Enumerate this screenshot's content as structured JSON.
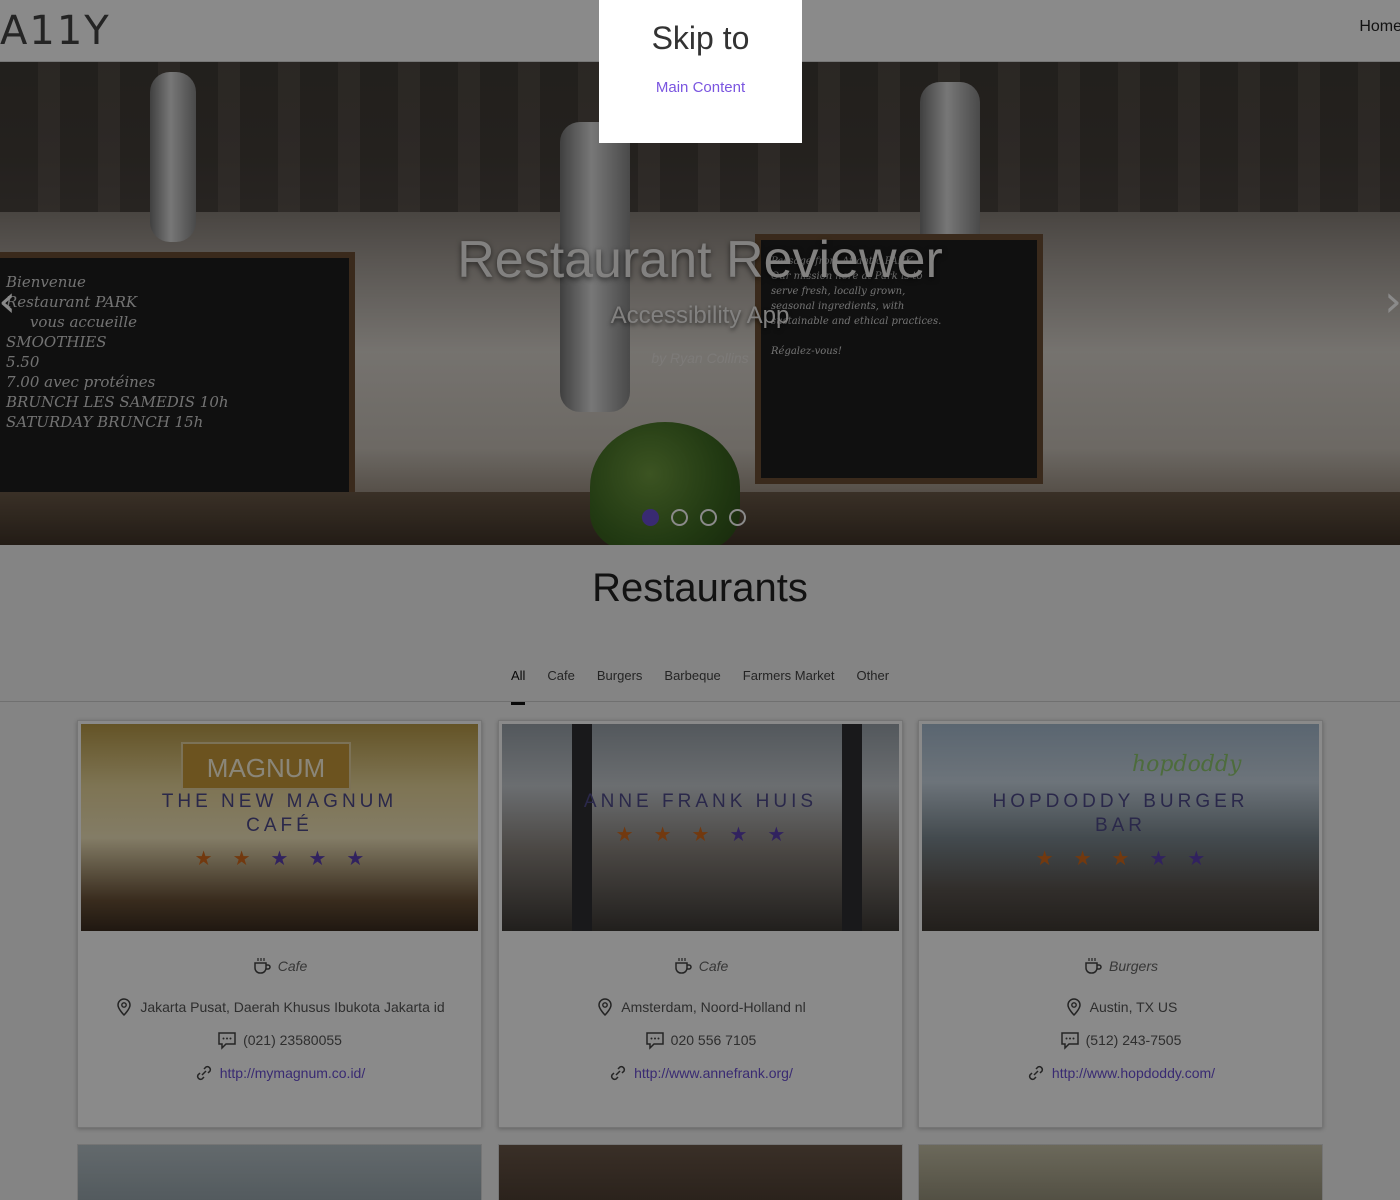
{
  "header": {
    "logo": "A11Y",
    "nav_home": "Home"
  },
  "hero": {
    "title": "Restaurant Reviewer",
    "subtitle": "Accessibility App",
    "byline": "by Ryan Collins",
    "prev_label": "‹",
    "next_label": "›",
    "slide_count": 4,
    "active_slide": 1,
    "board_left_text": "Bienvenue\nRestaurant PARK\n     vous accueille\nSMOOTHIES\n5.50\n7.00 avec protéines\nBRUNCH LES SAMEDIS 10h\nSATURDAY BRUNCH 15h",
    "board_right_text": "Passage from Atlantic PARK\nOur mission here at Park is to\nserve fresh, locally grown,\nseasonal ingredients, with\nsustainable and ethical practices.\n\nRégalez-vous!"
  },
  "restaurants": {
    "title": "Restaurants",
    "tabs": [
      {
        "label": "All",
        "active": true
      },
      {
        "label": "Cafe",
        "active": false
      },
      {
        "label": "Burgers",
        "active": false
      },
      {
        "label": "Barbeque",
        "active": false
      },
      {
        "label": "Farmers Market",
        "active": false
      },
      {
        "label": "Other",
        "active": false
      }
    ],
    "cards": [
      {
        "name": "THE NEW MAGNUM CAFÉ",
        "rating": 2,
        "max_rating": 5,
        "category": "Cafe",
        "address": "Jakarta Pusat, Daerah Khusus Ibukota Jakarta id",
        "phone": "(021) 23580055",
        "url": "http://mymagnum.co.id/",
        "sign": "MAGNUM"
      },
      {
        "name": "ANNE FRANK HUIS",
        "rating": 3,
        "max_rating": 5,
        "category": "Cafe",
        "address": "Amsterdam, Noord-Holland nl",
        "phone": "020 556 7105",
        "url": "http://www.annefrank.org/",
        "sign": ""
      },
      {
        "name": "HOPDODDY BURGER BAR",
        "rating": 3,
        "max_rating": 5,
        "category": "Burgers",
        "address": "Austin, TX US",
        "phone": "(512) 243-7505",
        "url": "http://www.hopdoddy.com/",
        "sign": "hopdoddy"
      }
    ]
  },
  "skip_dialog": {
    "title": "Skip to",
    "link": "Main Content"
  },
  "colors": {
    "accent": "#6a4fd3",
    "star_on": "#d26a1c",
    "star_off": "#5b3fb0",
    "link": "#7a55e0"
  }
}
